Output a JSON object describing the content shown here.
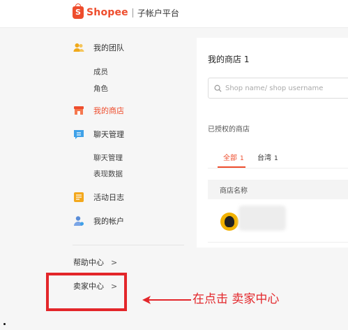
{
  "header": {
    "logo_glyph": "S",
    "brand": "Shopee",
    "subtitle": "子帐户平台"
  },
  "sidebar": {
    "team": {
      "label": "我的团队",
      "icon": "team-icon",
      "subs": [
        "成员",
        "角色"
      ]
    },
    "shop": {
      "label": "我的商店",
      "icon": "shop-icon",
      "active": true
    },
    "chat": {
      "label": "聊天管理",
      "icon": "chat-icon",
      "subs": [
        "聊天管理",
        "表现数据"
      ]
    },
    "log": {
      "label": "活动日志",
      "icon": "activity-log-icon"
    },
    "account": {
      "label": "我的帐户",
      "icon": "account-icon"
    },
    "help": {
      "label": "帮助中心",
      "chevron": ">"
    },
    "seller": {
      "label": "卖家中心",
      "chevron": ">"
    }
  },
  "main": {
    "title": "我的商店 1",
    "search_placeholder": "Shop name/ shop username",
    "authorized_label": "已授权的商店",
    "tabs": [
      {
        "label": "全部",
        "count": "1",
        "active": true
      },
      {
        "label": "台湾",
        "count": "1",
        "active": false
      }
    ],
    "table_header": "商店名称"
  },
  "annotation": {
    "text": "在点击 卖家中心"
  },
  "colors": {
    "accent": "#ee4d2d",
    "annotation": "#e3262a"
  }
}
